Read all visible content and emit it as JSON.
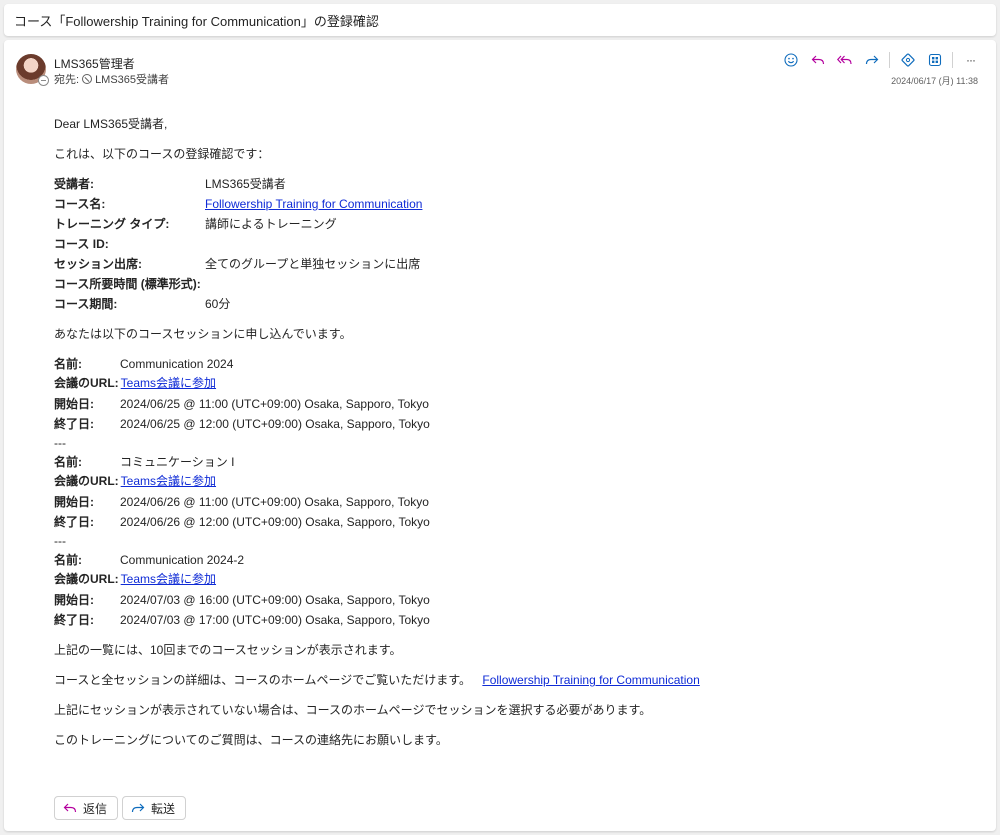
{
  "subject": "コース「Followership Training for Communication」の登録確認",
  "header": {
    "sender": "LMS365管理者",
    "to_label": "宛先:",
    "recipient": "LMS365受講者",
    "timestamp": "2024/06/17 (月) 11:38",
    "toolbar_icons": [
      "emoji-icon",
      "reply-icon",
      "reply-all-icon",
      "forward-icon",
      "loop-icon",
      "apps-icon",
      "more-icon"
    ],
    "more_label": "···"
  },
  "body": {
    "greeting": "Dear LMS365受講者,",
    "intro": "これは、以下のコースの登録確認です：",
    "details": [
      {
        "key": "受講者:",
        "value": "LMS365受講者",
        "link": false
      },
      {
        "key": "コース名:",
        "value": "Followership Training for Communication",
        "link": true
      },
      {
        "key": "トレーニング タイプ:",
        "value": "講師によるトレーニング",
        "link": false
      },
      {
        "key": "コース ID:",
        "value": "",
        "link": false
      },
      {
        "key": "セッション出席:",
        "value": "全てのグループと単独セッションに出席",
        "link": false
      },
      {
        "key": "コース所要時間 (標準形式):",
        "value": "",
        "link": false
      },
      {
        "key": "コース期間:",
        "value": "60分",
        "link": false
      }
    ],
    "sessions_intro": "あなたは以下のコースセッションに申し込んでいます。",
    "session_labels": {
      "name": "名前:",
      "url": "会議のURL:",
      "start": "開始日:",
      "end": "終了日:"
    },
    "separator": "---",
    "sessions": [
      {
        "name": "Communication 2024",
        "url": "Teams会議に参加",
        "start": "2024/06/25 @ 11:00 (UTC+09:00) Osaka, Sapporo, Tokyo",
        "end": "2024/06/25 @ 12:00 (UTC+09:00) Osaka, Sapporo, Tokyo"
      },
      {
        "name": "コミュニケーション I",
        "url": "Teams会議に参加",
        "start": "2024/06/26 @ 11:00 (UTC+09:00) Osaka, Sapporo, Tokyo",
        "end": "2024/06/26 @ 12:00 (UTC+09:00) Osaka, Sapporo, Tokyo"
      },
      {
        "name": "Communication 2024-2",
        "url": "Teams会議に参加",
        "start": "2024/07/03 @ 16:00 (UTC+09:00) Osaka, Sapporo, Tokyo",
        "end": "2024/07/03 @ 17:00 (UTC+09:00) Osaka, Sapporo, Tokyo"
      }
    ],
    "note_limit": "上記の一覧には、10回までのコースセッションが表示されます。",
    "note_details": "コースと全セッションの詳細は、コースのホームページでご覧いただけます。",
    "note_details_link": "Followership Training for Communication",
    "note_missing": "上記にセッションが表示されていない場合は、コースのホームページでセッションを選択する必要があります。",
    "note_contact": "このトレーニングについてのご質問は、コースの連絡先にお願いします。"
  },
  "actions": {
    "reply": "返信",
    "forward": "転送"
  },
  "colors": {
    "link": "#0f2bd6",
    "reply_icon": "#b4009e",
    "forward_icon": "#0f6cbd"
  }
}
